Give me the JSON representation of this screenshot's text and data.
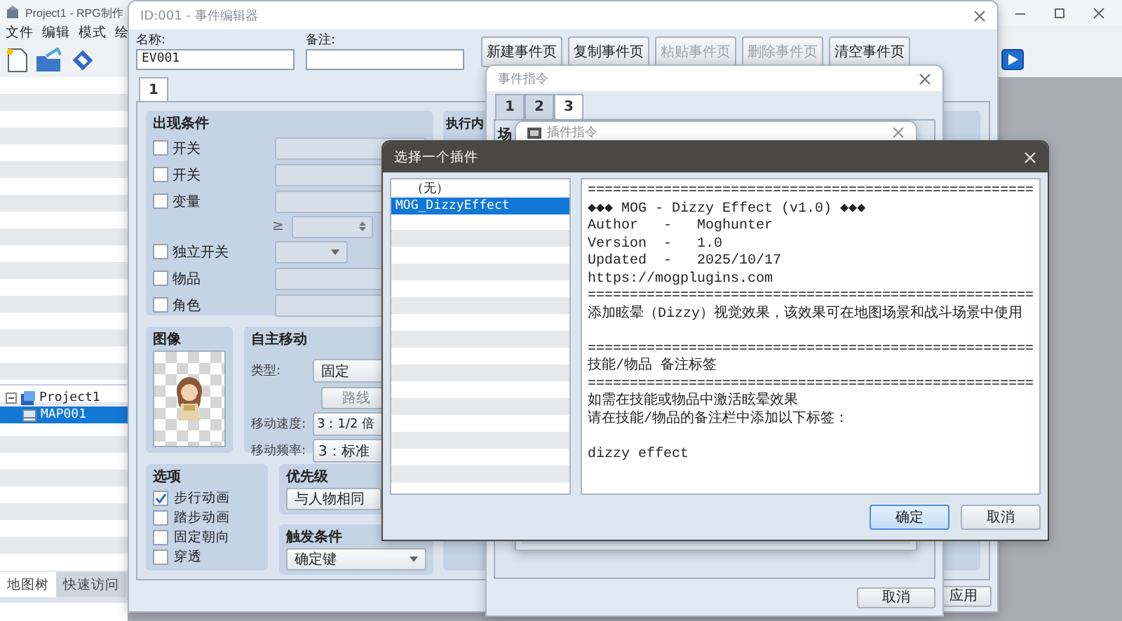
{
  "main_window": {
    "title": "Project1 - RPG制作",
    "menu": [
      {
        "label": "文件"
      },
      {
        "label": "编辑"
      },
      {
        "label": "模式"
      },
      {
        "label": "绘"
      }
    ],
    "map_tree": [
      {
        "label": "Project1",
        "expanded": true,
        "children": [
          {
            "label": "MAP001",
            "selected": true
          }
        ]
      }
    ],
    "panel_tabs": [
      {
        "label": "地图树",
        "selected": true
      },
      {
        "label": "快速访问",
        "selected": false
      }
    ]
  },
  "event_editor": {
    "title": "ID:001 - 事件编辑器",
    "name_label": "名称:",
    "name_value": "EV001",
    "note_label": "备注:",
    "page_buttons": [
      {
        "label": "新建事件页",
        "disabled": false
      },
      {
        "label": "复制事件页",
        "disabled": false
      },
      {
        "label": "粘贴事件页",
        "disabled": true
      },
      {
        "label": "删除事件页",
        "disabled": true
      },
      {
        "label": "清空事件页",
        "disabled": false
      }
    ],
    "page_tabs": [
      {
        "label": "1",
        "selected": true
      }
    ],
    "conditions": {
      "title": "出现条件",
      "items": [
        {
          "kind": "field",
          "label": "开关",
          "checked": false
        },
        {
          "kind": "field",
          "label": "开关",
          "checked": false
        },
        {
          "kind": "field",
          "label": "变量",
          "checked": false
        },
        {
          "kind": "compare",
          "label": "≥"
        },
        {
          "kind": "dropdown",
          "label": "独立开关",
          "checked": false
        },
        {
          "kind": "field",
          "label": "物品",
          "checked": false
        },
        {
          "kind": "field",
          "label": "角色",
          "checked": false
        }
      ]
    },
    "contents_title": "执行内",
    "image": {
      "title": "图像"
    },
    "autonomous_movement": {
      "title": "自主移动",
      "type_label": "类型:",
      "type_value": "固定",
      "route_button": "路线",
      "speed_label": "移动速度:",
      "speed_value": "3：1/2 倍",
      "frequency_label": "移动频率:",
      "frequency_value": "3：标准"
    },
    "options": {
      "title": "选项",
      "items": [
        {
          "label": "步行动画",
          "checked": true
        },
        {
          "label": "踏步动画",
          "checked": false
        },
        {
          "label": "固定朝向",
          "checked": false
        },
        {
          "label": "穿透",
          "checked": false
        }
      ]
    },
    "priority": {
      "title": "优先级",
      "value": "与人物相同"
    },
    "trigger": {
      "title": "触发条件",
      "value": "确定键"
    },
    "buttons": [
      {
        "label": "应用"
      }
    ]
  },
  "event_commands": {
    "title": "事件指令",
    "tabs": [
      {
        "label": "1",
        "selected": false
      },
      {
        "label": "2",
        "selected": false
      },
      {
        "label": "3",
        "selected": true
      }
    ],
    "section_title": "场",
    "buttons": [
      {
        "label": "取消"
      }
    ]
  },
  "plugin_command": {
    "title": "插件指令"
  },
  "plugin_dialog": {
    "title": "选择一个插件",
    "plugins": [
      {
        "label": "（无）",
        "selected": false
      },
      {
        "label": "MOG_DizzyEffect",
        "selected": true
      }
    ],
    "description": [
      {
        "kind": "text",
        "text": "====================================================="
      },
      {
        "kind": "text",
        "text": "◆◆◆ MOG - Dizzy Effect (v1.0) ◆◆◆"
      },
      {
        "kind": "text",
        "text": "Author   -   Moghunter"
      },
      {
        "kind": "text",
        "text": "Version  -   1.0"
      },
      {
        "kind": "text",
        "text": "Updated  -   2025/10/17"
      },
      {
        "kind": "text",
        "text": "https://mogplugins.com"
      },
      {
        "kind": "text",
        "text": "====================================================="
      },
      {
        "kind": "text",
        "text": "添加眩晕（Dizzy）视觉效果，该效果可在地图场景和战斗场景中使用"
      },
      {
        "kind": "blank"
      },
      {
        "kind": "text",
        "text": "====================================================="
      },
      {
        "kind": "text",
        "text": "技能/物品 备注标签"
      },
      {
        "kind": "text",
        "text": "====================================================="
      },
      {
        "kind": "text",
        "text": "如需在技能或物品中激活眩晕效果"
      },
      {
        "kind": "text",
        "text": "请在技能/物品的备注栏中添加以下标签："
      },
      {
        "kind": "blank"
      },
      {
        "kind": "text",
        "text": "dizzy effect"
      }
    ],
    "buttons": [
      {
        "label": "确定",
        "focused": true
      },
      {
        "label": "取消",
        "focused": false
      }
    ]
  }
}
